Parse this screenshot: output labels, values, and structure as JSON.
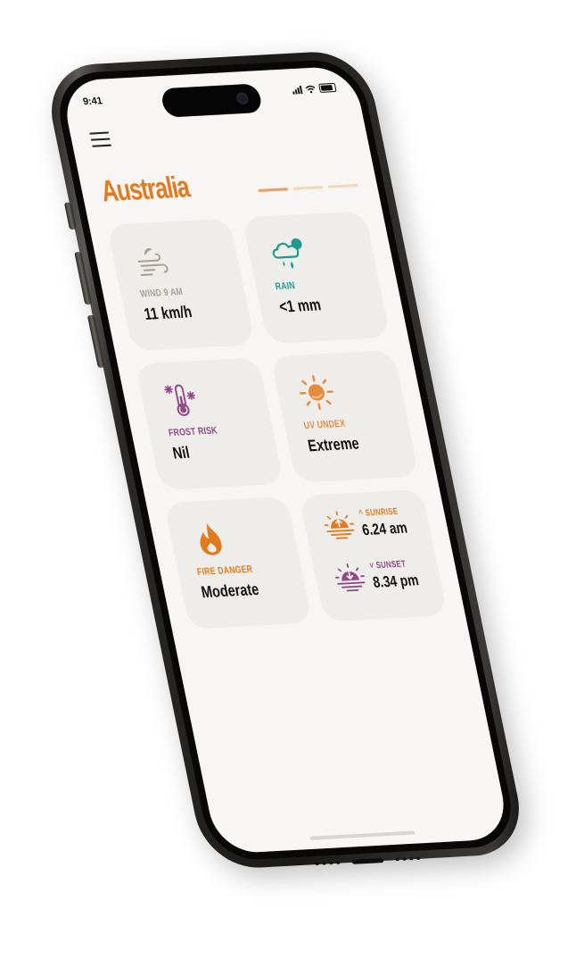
{
  "status_bar": {
    "time": "9:41"
  },
  "header": {
    "title": "Australia"
  },
  "pager": {
    "count": 3,
    "active_index": 0
  },
  "cards": {
    "wind": {
      "label": "WIND 9 AM",
      "value": "11 km/h"
    },
    "rain": {
      "label": "RAIN",
      "value": "<1 mm"
    },
    "frost": {
      "label": "FROST RISK",
      "value": "Nil"
    },
    "uv": {
      "label": "UV UNDEX",
      "value": "Extreme"
    },
    "fire": {
      "label": "FIRE DANGER",
      "value": "Moderate"
    },
    "sunrise": {
      "label": "SUNRISE",
      "value": "6.24 am"
    },
    "sunset": {
      "label": "SUNSET",
      "value": "8.34 pm"
    }
  },
  "icons": {
    "wind": "wind-icon",
    "rain": "rain-cloud-icon",
    "frost": "thermometer-snow-icon",
    "uv": "sun-icon",
    "fire": "flame-icon",
    "sunrise": "sunrise-icon",
    "sunset": "sunset-icon",
    "menu": "hamburger-menu-icon"
  },
  "colors": {
    "brand": "#e07b1f",
    "wind": "#a89f96",
    "rain": "#1e9a93",
    "frost": "#8e4a86",
    "uv": "#e58a3a",
    "fire": "#e07b1f",
    "sunrise": "#e07b1f",
    "sunset": "#8e4a86",
    "card_bg": "#efedea",
    "screen_bg": "#f8f6f4"
  }
}
